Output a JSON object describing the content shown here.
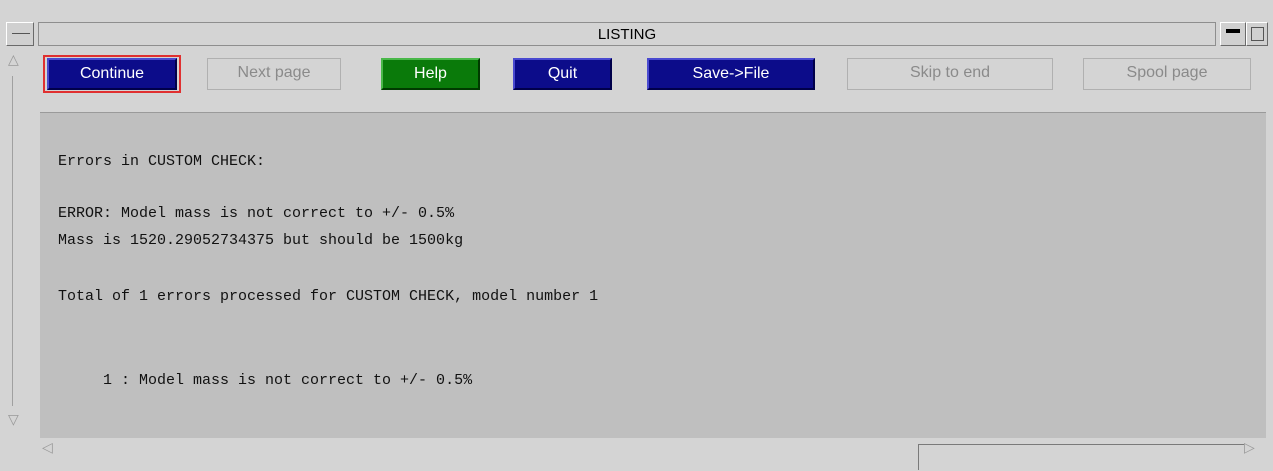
{
  "window": {
    "title": "LISTING"
  },
  "toolbar": {
    "continue": "Continue",
    "next_page": "Next page",
    "help": "Help",
    "quit": "Quit",
    "save_file": "Save->File",
    "skip_to_end": "Skip to end",
    "spool_page": "Spool page"
  },
  "colors": {
    "button_blue": "#0c0c8a",
    "button_green": "#0a7a0a",
    "focus_red": "#e03030",
    "content_bg": "#bfbfbf"
  },
  "listing": {
    "lines": [
      "Errors in CUSTOM CHECK:",
      "ERROR: Model mass is not correct to +/- 0.5%",
      "Mass is 1520.29052734375 but should be 1500kg",
      "Total of 1 errors processed for CUSTOM CHECK, model number 1",
      "     1 : Model mass is not correct to +/- 0.5%"
    ]
  }
}
